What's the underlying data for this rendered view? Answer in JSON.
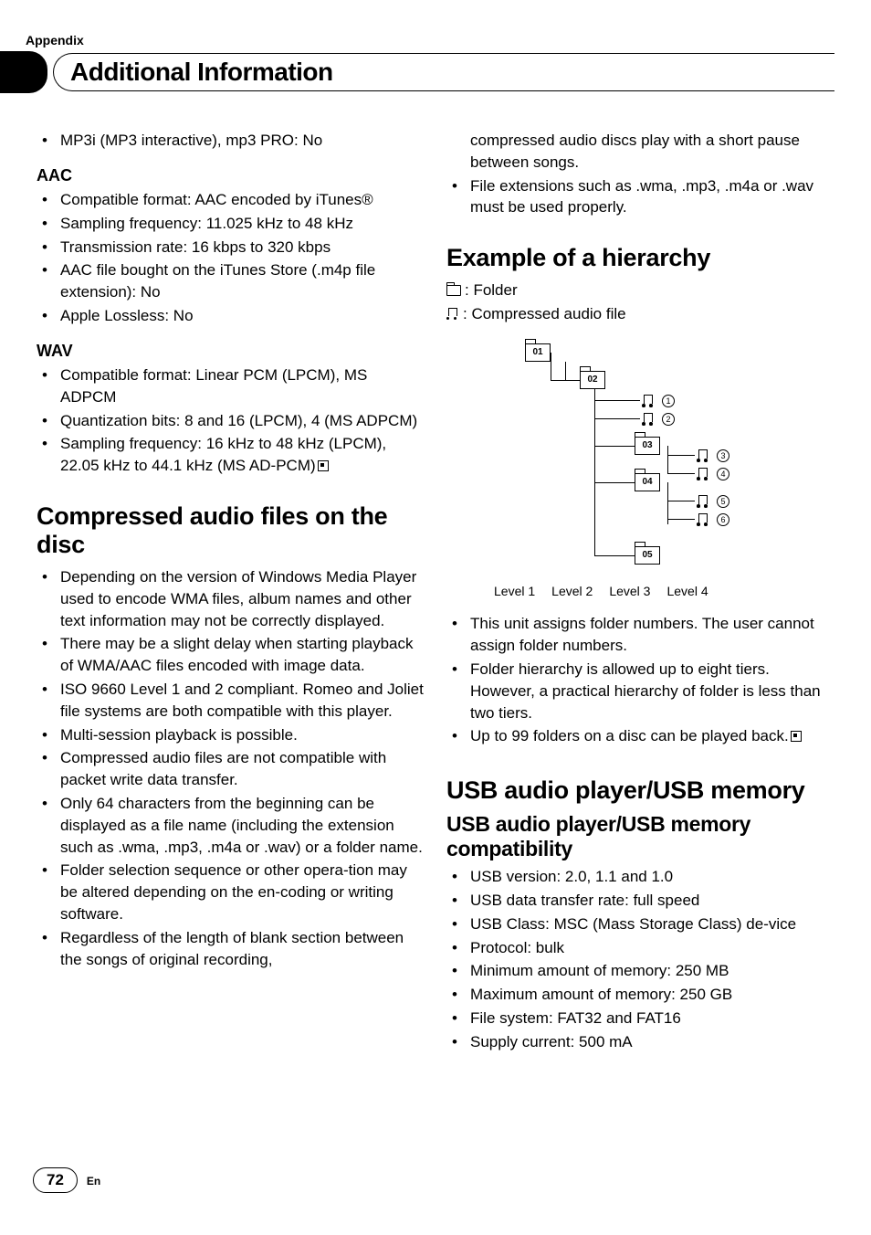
{
  "section_label": "Appendix",
  "page_title": "Additional Information",
  "left": {
    "top_item": "MP3i (MP3 interactive), mp3 PRO: No",
    "aac_heading": "AAC",
    "aac_items": [
      "Compatible format: AAC encoded by iTunes®",
      "Sampling frequency: 11.025 kHz to 48 kHz",
      "Transmission rate: 16 kbps to 320 kbps",
      "AAC file bought on the iTunes Store (.m4p file extension): No",
      "Apple Lossless: No"
    ],
    "wav_heading": "WAV",
    "wav_items": [
      "Compatible format: Linear PCM (LPCM), MS ADPCM",
      "Quantization bits: 8 and 16 (LPCM), 4 (MS ADPCM)",
      "Sampling frequency: 16 kHz to 48 kHz (LPCM), 22.05 kHz to 44.1 kHz (MS AD-PCM)"
    ],
    "compressed_heading": "Compressed audio files on the disc",
    "compressed_items": [
      "Depending on the version of Windows Media Player used to encode WMA files, album names and other text information may not be correctly displayed.",
      "There may be a slight delay when starting playback of WMA/AAC files encoded with image data.",
      "ISO 9660 Level 1 and 2 compliant. Romeo and Joliet file systems are both compatible with this player.",
      "Multi-session playback is possible.",
      "Compressed audio files are not compatible with packet write data transfer.",
      "Only 64 characters from the beginning can be displayed as a file name (including the extension such as .wma, .mp3, .m4a or .wav) or a folder name.",
      "Folder selection sequence or other opera-tion may be altered depending on the en-coding or writing software.",
      "Regardless of the length of blank section between the songs of original recording,"
    ]
  },
  "right": {
    "top_continuation": "compressed audio discs play with a short pause between songs.",
    "top_item2": "File extensions such as .wma, .mp3, .m4a or .wav must be used properly.",
    "hierarchy_heading": "Example of a hierarchy",
    "legend_folder": ": Folder",
    "legend_file": ": Compressed audio file",
    "folders": [
      "01",
      "02",
      "03",
      "04",
      "05"
    ],
    "levels": [
      "Level 1",
      "Level 2",
      "Level 3",
      "Level 4"
    ],
    "hierarchy_items": [
      "This unit assigns folder numbers. The user cannot assign folder numbers.",
      "Folder hierarchy is allowed up to eight tiers. However, a practical hierarchy of folder is less than two tiers.",
      "Up to 99 folders on a disc can be played back."
    ],
    "usb_heading": "USB audio player/USB memory",
    "usb_sub_heading": "USB audio player/USB memory compatibility",
    "usb_items": [
      "USB version: 2.0, 1.1 and 1.0",
      "USB data transfer rate: full speed",
      "USB Class: MSC (Mass Storage Class) de-vice",
      "Protocol: bulk",
      "Minimum amount of memory: 250 MB",
      "Maximum amount of memory: 250 GB",
      "File system: FAT32 and FAT16",
      "Supply current: 500 mA"
    ]
  },
  "page_number": "72",
  "lang": "En"
}
